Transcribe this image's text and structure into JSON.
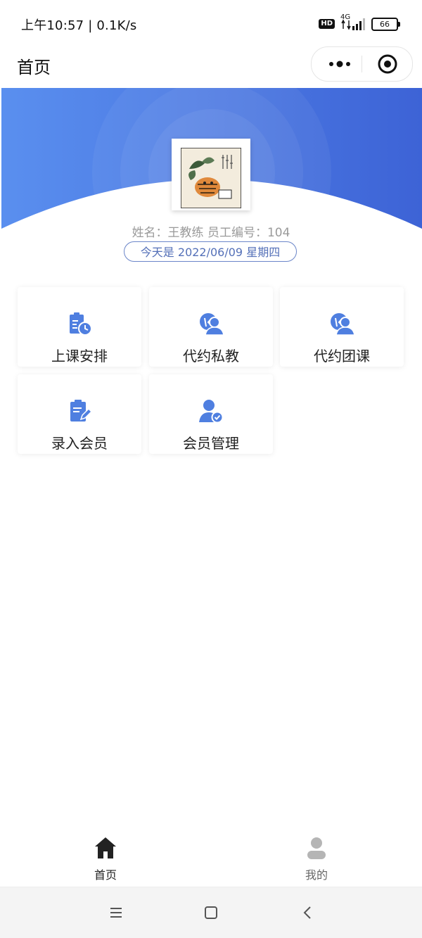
{
  "status_bar": {
    "time": "上午10:57 | 0.1K/s",
    "hd": "HD",
    "network": "4G",
    "battery": "66"
  },
  "nav": {
    "title": "首页",
    "more_icon": "more-dots-icon",
    "close_icon": "target-circle-icon"
  },
  "profile": {
    "info": "姓名：王教练 员工编号：104",
    "date": "今天是 2022/06/09 星期四",
    "avatar": "avatar-image"
  },
  "menu": [
    {
      "label": "上课安排",
      "icon": "schedule-clock-icon"
    },
    {
      "label": "代约私教",
      "icon": "private-coach-icon"
    },
    {
      "label": "代约团课",
      "icon": "group-class-icon"
    },
    {
      "label": "录入会员",
      "icon": "clipboard-edit-icon"
    },
    {
      "label": "会员管理",
      "icon": "member-check-icon"
    }
  ],
  "tabbar": {
    "home": "首页",
    "mine": "我的"
  },
  "colors": {
    "accent": "#4f7fe0",
    "header_gradient_start": "#5a8fef",
    "header_gradient_end": "#3d63d6",
    "tab_active": "#222222",
    "tab_inactive": "#b5b5b5"
  }
}
